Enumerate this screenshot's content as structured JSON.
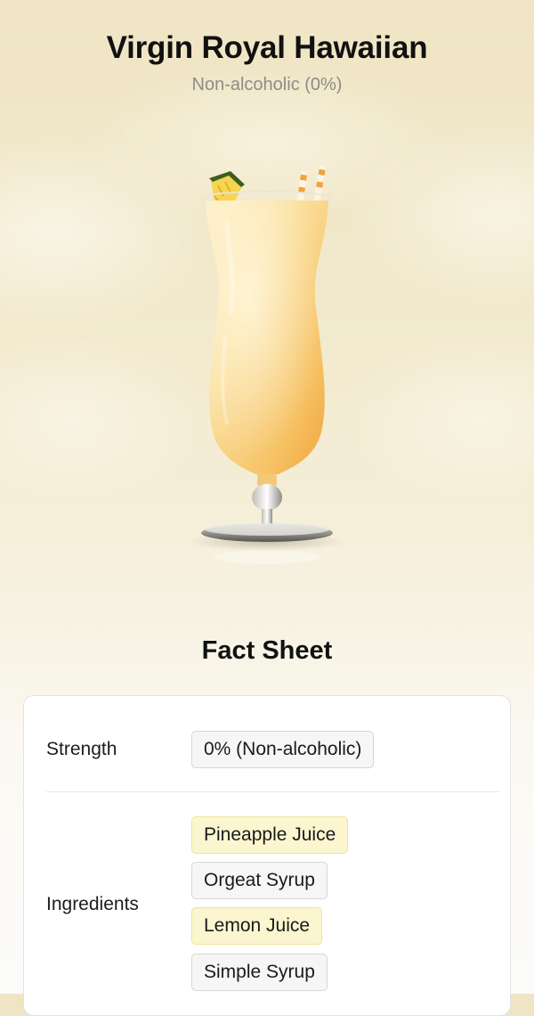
{
  "drink": {
    "title": "Virgin Royal Hawaiian",
    "subtitle": "Non-alcoholic (0%)"
  },
  "fact_sheet": {
    "heading": "Fact Sheet",
    "strength": {
      "label": "Strength",
      "value": "0% (Non-alcoholic)"
    },
    "ingredients": {
      "label": "Ingredients",
      "items": [
        {
          "name": "Pineapple Juice",
          "style": "highlight"
        },
        {
          "name": "Orgeat Syrup",
          "style": "plain"
        },
        {
          "name": "Lemon Juice",
          "style": "highlight"
        },
        {
          "name": "Simple Syrup",
          "style": "plain"
        }
      ]
    }
  },
  "colors": {
    "background_top": "#efe5c5",
    "drink_orange": "#f0b24a",
    "drink_cream": "#fbe4a8",
    "chip_highlight": "#fbf6cf",
    "chip_plain": "#f6f6f6"
  }
}
